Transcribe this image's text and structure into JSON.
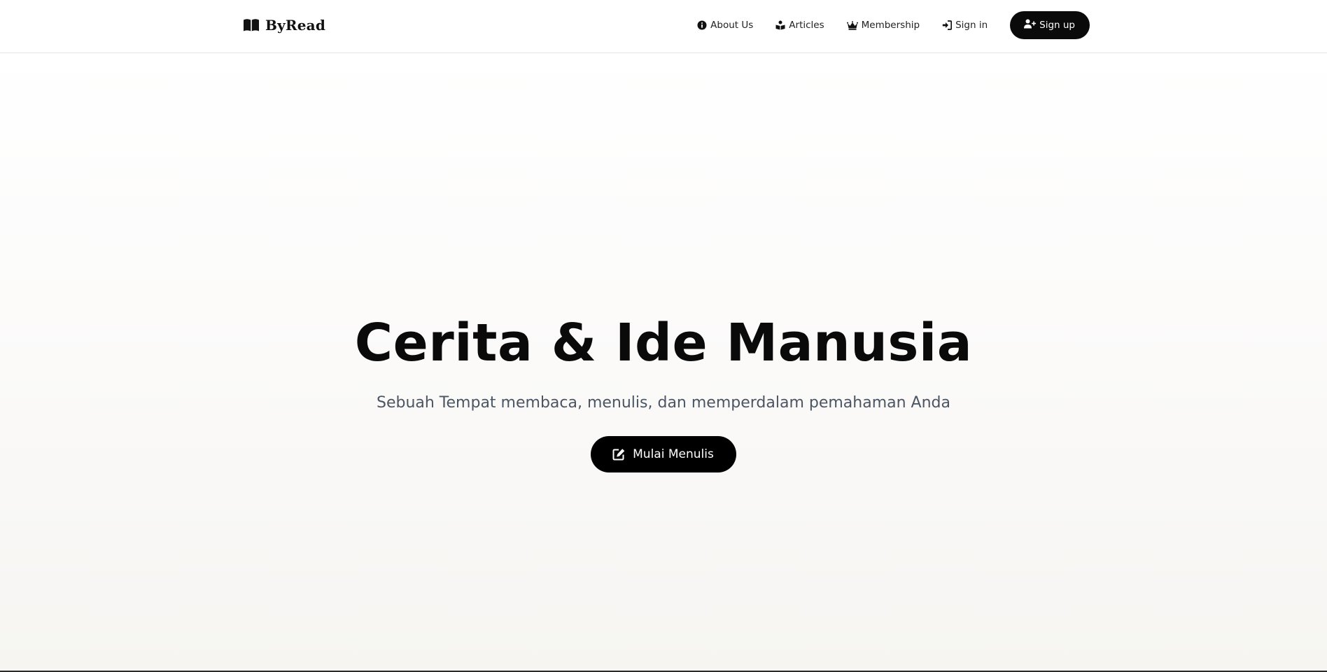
{
  "nav": {
    "brand": "ByRead",
    "brand_icon": "open-book-icon",
    "links": [
      {
        "label": "About Us",
        "icon": "info-circle-icon"
      },
      {
        "label": "Articles",
        "icon": "book-reader-icon"
      },
      {
        "label": "Membership",
        "icon": "crown-icon"
      },
      {
        "label": "Sign in",
        "icon": "sign-in-icon"
      }
    ],
    "signup": {
      "label": "Sign up",
      "icon": "user-plus-icon"
    }
  },
  "hero": {
    "title": "Cerita & Ide Manusia",
    "subtitle": "Sebuah Tempat membaca, menulis, dan memperdalam pemahaman Anda",
    "cta": {
      "label": "Mulai Menulis",
      "icon": "edit-icon"
    }
  },
  "colors": {
    "primary": "#0a0a0a",
    "subtitle": "#4b5563",
    "navbar_border": "#e6e6e6"
  }
}
